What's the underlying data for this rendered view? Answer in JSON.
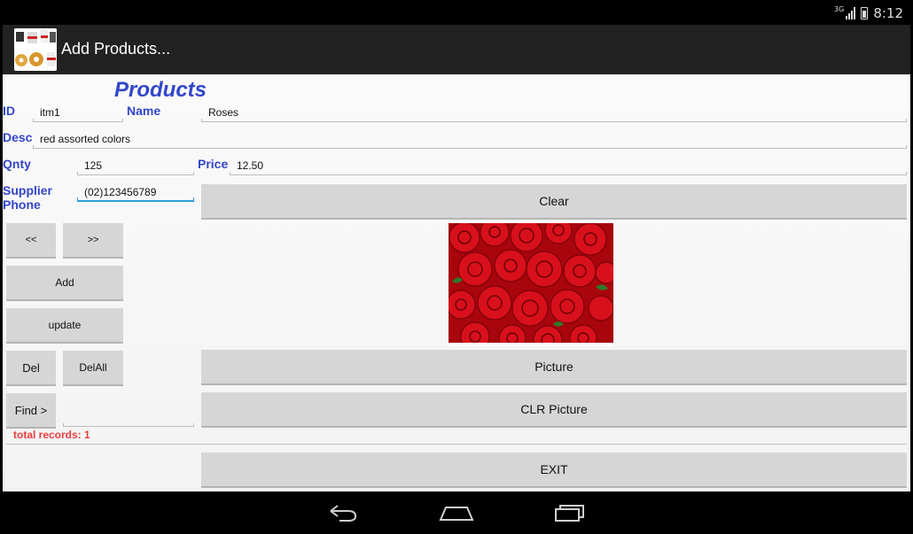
{
  "status_bar": {
    "network": "3G",
    "time": "8:12"
  },
  "action_bar": {
    "title": "Add Products..."
  },
  "form": {
    "heading": "Products",
    "id_label": "ID",
    "id_value": "itm1",
    "name_label": "Name",
    "name_value": "Roses",
    "desc_label": "Desc",
    "desc_value": "red assorted colors",
    "qnty_label": "Qnty",
    "qnty_value": "125",
    "price_label": "Price",
    "price_value": "12.50",
    "supplier_label_1": "Supplier",
    "supplier_label_2": "Phone",
    "supplier_value": "(02)123456789",
    "find_value": ""
  },
  "buttons": {
    "prev": "<<",
    "next": ">>",
    "add": "Add",
    "update": "update",
    "del": "Del",
    "delall": "DelAll",
    "find": "Find >",
    "clear": "Clear",
    "picture": "Picture",
    "clr_picture": "CLR Picture",
    "exit": "EXIT"
  },
  "records": "total records: 1",
  "nav": {
    "icons": [
      "back-icon",
      "home-icon",
      "recents-icon"
    ]
  },
  "colors": {
    "label_blue": "#3246c8",
    "records_red": "#e83e3e",
    "focus_blue": "#2b9fd6"
  }
}
